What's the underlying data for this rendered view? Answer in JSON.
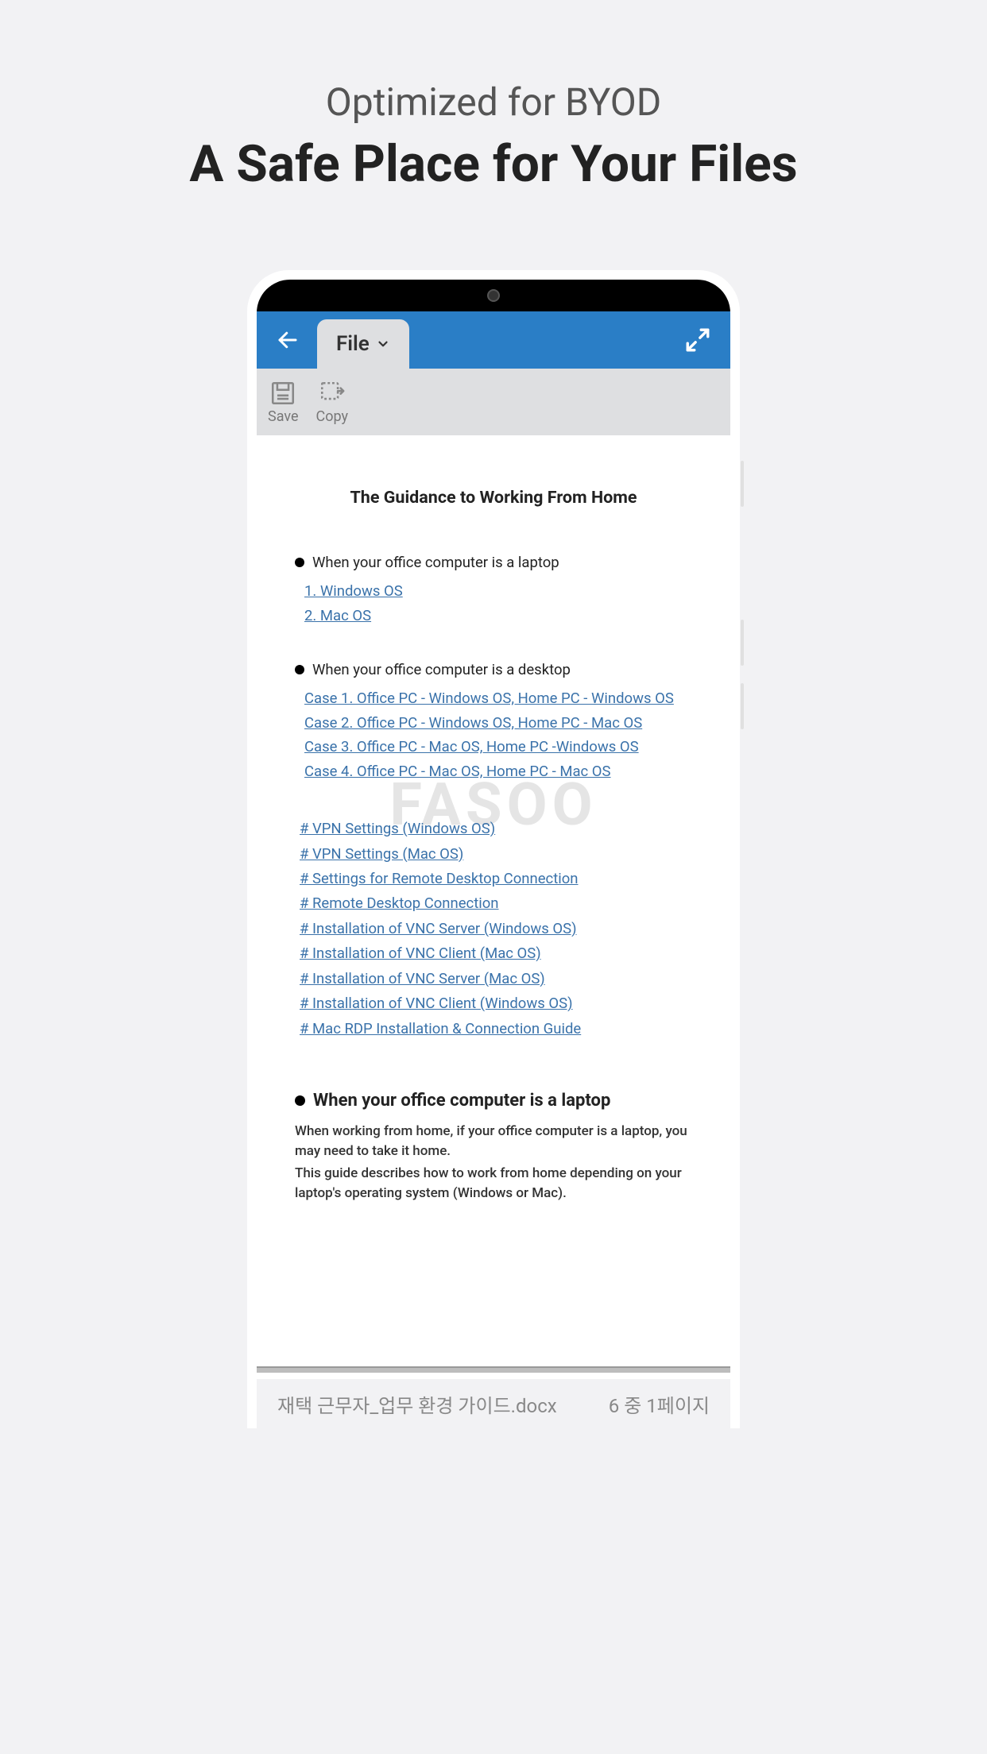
{
  "marketing": {
    "subtitle": "Optimized for BYOD",
    "title": "A Safe Place for Your Files"
  },
  "toolbar": {
    "file_tab": "File",
    "save_label": "Save",
    "copy_label": "Copy"
  },
  "document": {
    "title": "The Guidance to Working From Home",
    "watermark": "FASOO",
    "section1": {
      "heading": "When your office computer is a laptop",
      "links": [
        "1. Windows OS",
        "2. Mac OS"
      ]
    },
    "section2": {
      "heading": "When your office computer is a desktop",
      "links": [
        "Case 1. Office PC - Windows OS, Home PC - Windows OS",
        "Case 2. Office PC - Windows OS, Home PC - Mac OS",
        "Case 3. Office PC - Mac OS, Home PC -Windows OS",
        "Case 4. Office PC - Mac OS, Home PC - Mac OS"
      ]
    },
    "hash_links": [
      "# VPN Settings (Windows OS)",
      "# VPN Settings (Mac OS)",
      "# Settings for Remote Desktop Connection",
      "# Remote Desktop Connection",
      "# Installation of VNC Server (Windows OS)",
      "# Installation of VNC Client (Mac OS)",
      "# Installation of VNC Server (Mac OS)",
      "# Installation of VNC Client (Windows OS)",
      "# Mac RDP Installation & Connection Guide"
    ],
    "body": {
      "heading": "When your office computer is a laptop",
      "p1": "When working from home, if your office computer is a laptop, you may need to take it home.",
      "p2": "This guide describes how to work from home depending on your laptop's operating system (Windows or Mac)."
    }
  },
  "footer": {
    "filename": "재택 근무자_업무 환경 가이드.docx",
    "page_info": "6 중 1페이지"
  }
}
